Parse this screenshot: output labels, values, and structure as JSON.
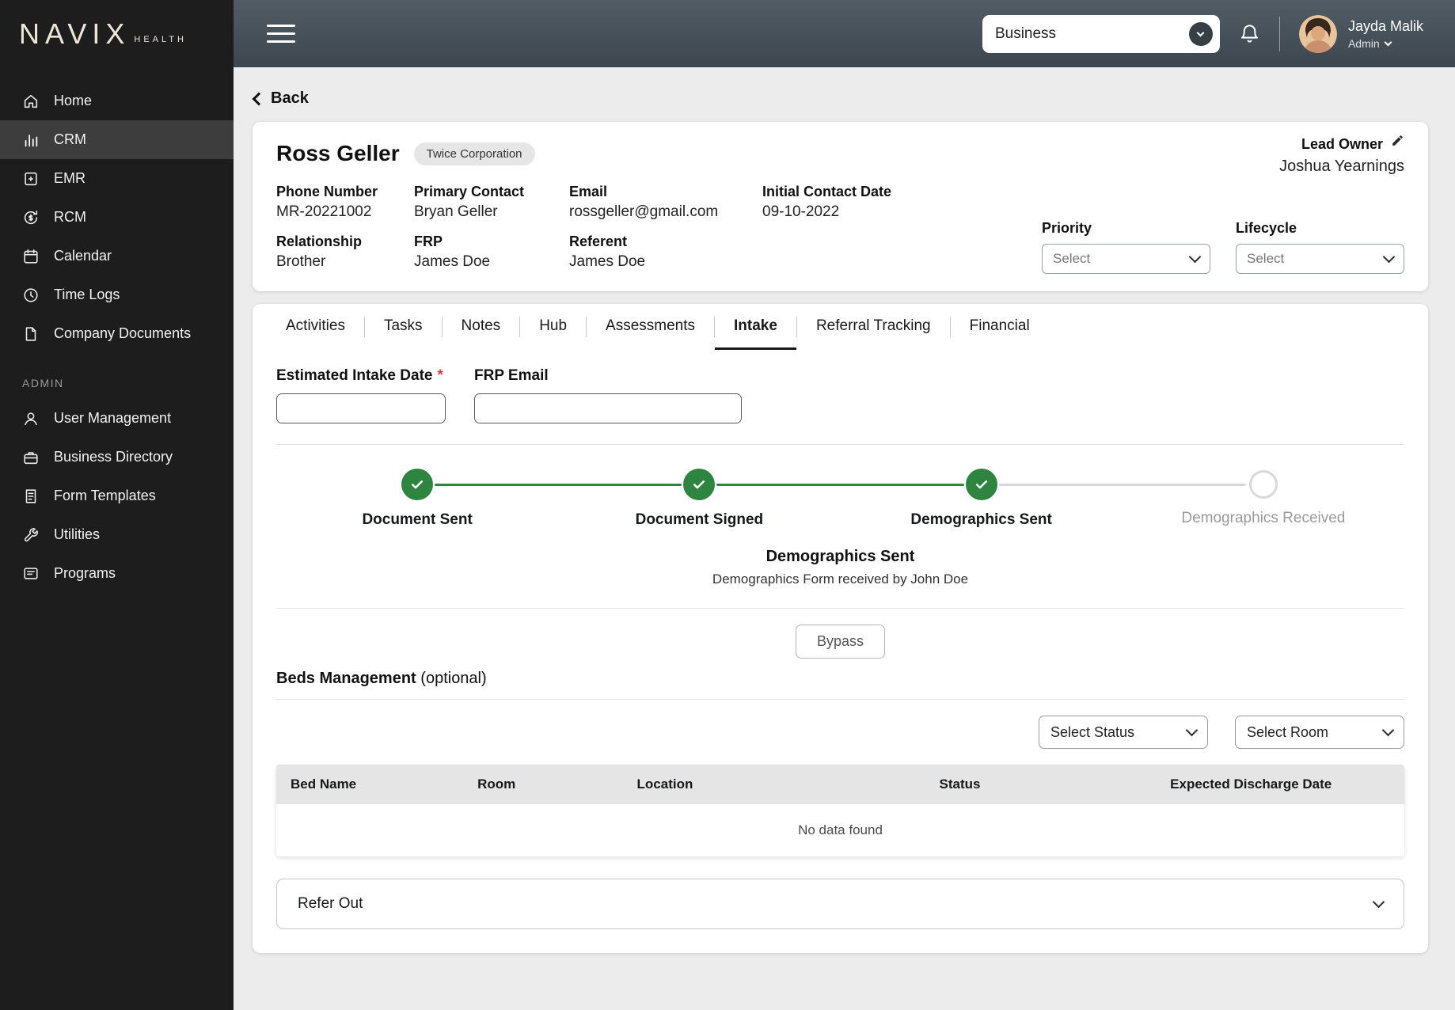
{
  "brand": {
    "name": "NAVIX",
    "sub": "HEALTH"
  },
  "topbar": {
    "business_label": "Business",
    "user_name": "Jayda Malik",
    "user_role": "Admin"
  },
  "sidebar": {
    "items": [
      {
        "label": "Home"
      },
      {
        "label": "CRM"
      },
      {
        "label": "EMR"
      },
      {
        "label": "RCM"
      },
      {
        "label": "Calendar"
      },
      {
        "label": "Time Logs"
      },
      {
        "label": "Company Documents"
      }
    ],
    "admin_header": "ADMIN",
    "admin_items": [
      {
        "label": "User Management"
      },
      {
        "label": "Business Directory"
      },
      {
        "label": "Form Templates"
      },
      {
        "label": "Utilities"
      },
      {
        "label": "Programs"
      }
    ]
  },
  "page": {
    "back_label": "Back"
  },
  "lead": {
    "name": "Ross Geller",
    "badge": "Twice Corporation",
    "lead_owner_label": "Lead Owner",
    "lead_owner_value": "Joshua Yearnings",
    "fields": [
      {
        "label": "Phone Number",
        "value": "MR-20221002"
      },
      {
        "label": "Primary Contact",
        "value": "Bryan Geller"
      },
      {
        "label": "Email",
        "value": "rossgeller@gmail.com"
      },
      {
        "label": "Initial Contact Date",
        "value": "09-10-2022"
      },
      {
        "label": "Relationship",
        "value": "Brother"
      },
      {
        "label": "FRP",
        "value": "James Doe"
      },
      {
        "label": "Referent",
        "value": "James Doe"
      }
    ],
    "priority_label": "Priority",
    "priority_value": "Select",
    "lifecycle_label": "Lifecycle",
    "lifecycle_value": "Select"
  },
  "tabs": [
    {
      "label": "Activities"
    },
    {
      "label": "Tasks"
    },
    {
      "label": "Notes"
    },
    {
      "label": "Hub"
    },
    {
      "label": "Assessments"
    },
    {
      "label": "Intake"
    },
    {
      "label": "Referral Tracking"
    },
    {
      "label": "Financial"
    }
  ],
  "intake": {
    "date_label": "Estimated Intake Date",
    "required_mark": "*",
    "date_value": "",
    "frp_email_label": "FRP Email",
    "frp_email_value": "",
    "steps": [
      {
        "label": "Document Sent",
        "state": "done"
      },
      {
        "label": "Document Signed",
        "state": "done"
      },
      {
        "label": "Demographics Sent",
        "state": "done"
      },
      {
        "label": "Demographics Received",
        "state": "pending"
      }
    ],
    "status_title": "Demographics Sent",
    "status_detail": "Demographics Form received by John Doe",
    "bypass_label": "Bypass",
    "beds_title": "Beds Management",
    "beds_suffix": "(optional)",
    "select_status_label": "Select Status",
    "select_room_label": "Select Room",
    "table_headers": [
      "Bed Name",
      "Room",
      "Location",
      "Status",
      "Expected Discharge Date"
    ],
    "empty_text": "No data found",
    "refer_out_label": "Refer Out"
  },
  "colors": {
    "accent_green": "#2e8540",
    "sidebar_bg": "#1d1d1d"
  }
}
